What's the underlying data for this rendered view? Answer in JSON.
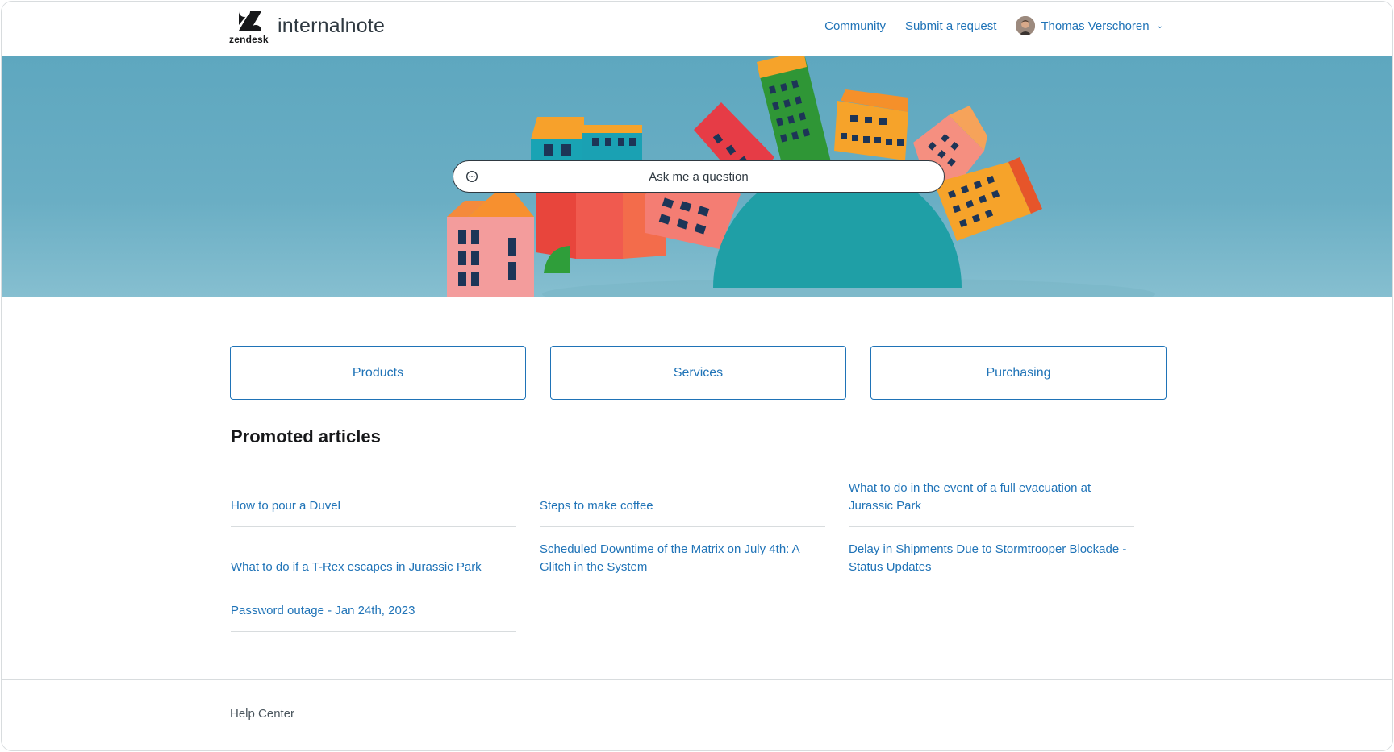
{
  "header": {
    "brand_small": "zendesk",
    "brand": "internalnote",
    "nav": {
      "community": "Community",
      "submit": "Submit a request",
      "user_name": "Thomas Verschoren"
    }
  },
  "hero": {
    "search_placeholder": "Ask me a question"
  },
  "categories": [
    {
      "label": "Products"
    },
    {
      "label": "Services"
    },
    {
      "label": "Purchasing"
    }
  ],
  "promoted": {
    "title": "Promoted articles",
    "articles": [
      "How to pour a Duvel",
      "Steps to make coffee",
      "What to do in the event of a full evacuation at Jurassic Park",
      "What to do if a T-Rex escapes in Jurassic Park",
      "Scheduled Downtime of the Matrix on July 4th: A Glitch in the System",
      "Delay in Shipments Due to Stormtrooper Blockade - Status Updates",
      "Password outage - Jan 24th, 2023"
    ]
  },
  "footer": {
    "label": "Help Center"
  },
  "colors": {
    "link": "#1f73b7",
    "hero_bg": "#5ea7bf",
    "divider": "#d8dcde"
  }
}
